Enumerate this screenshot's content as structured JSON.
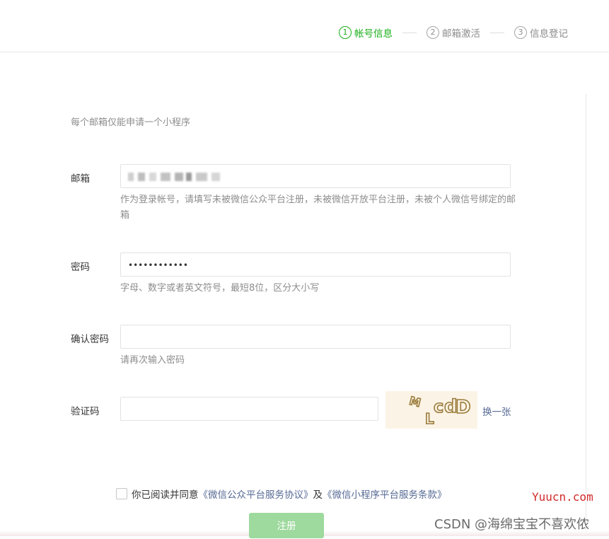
{
  "steps": [
    {
      "num": "1",
      "label": "帐号信息"
    },
    {
      "num": "2",
      "label": "邮箱激活"
    },
    {
      "num": "3",
      "label": "信息登记"
    }
  ],
  "tip": "每个邮箱仅能申请一个小程序",
  "form": {
    "email": {
      "label": "邮箱",
      "hint": "作为登录帐号，请填写未被微信公众平台注册，未被微信开放平台注册，未被个人微信号绑定的邮箱"
    },
    "password": {
      "label": "密码",
      "value": "••••••••••••",
      "hint": "字母、数字或者英文符号，最短8位，区分大小写"
    },
    "confirm_password": {
      "label": "确认密码",
      "value": "",
      "hint": "请再次输入密码"
    },
    "captcha": {
      "label": "验证码",
      "value": "",
      "image_text": "MLcdD",
      "refresh_label": "换一张"
    }
  },
  "agreement": {
    "prefix": "你已阅读并同意",
    "link1": "《微信公众平台服务协议》",
    "conjunction": "及",
    "link2": "《微信小程序平台服务条款》"
  },
  "register_label": "注册",
  "watermarks": {
    "site": "Yuucn.com",
    "csdn": "CSDN @海绵宝宝不喜欢侬"
  },
  "colors": {
    "accent_green": "#1aad19",
    "link_blue": "#576b95",
    "disabled_button": "#9ed99d"
  }
}
